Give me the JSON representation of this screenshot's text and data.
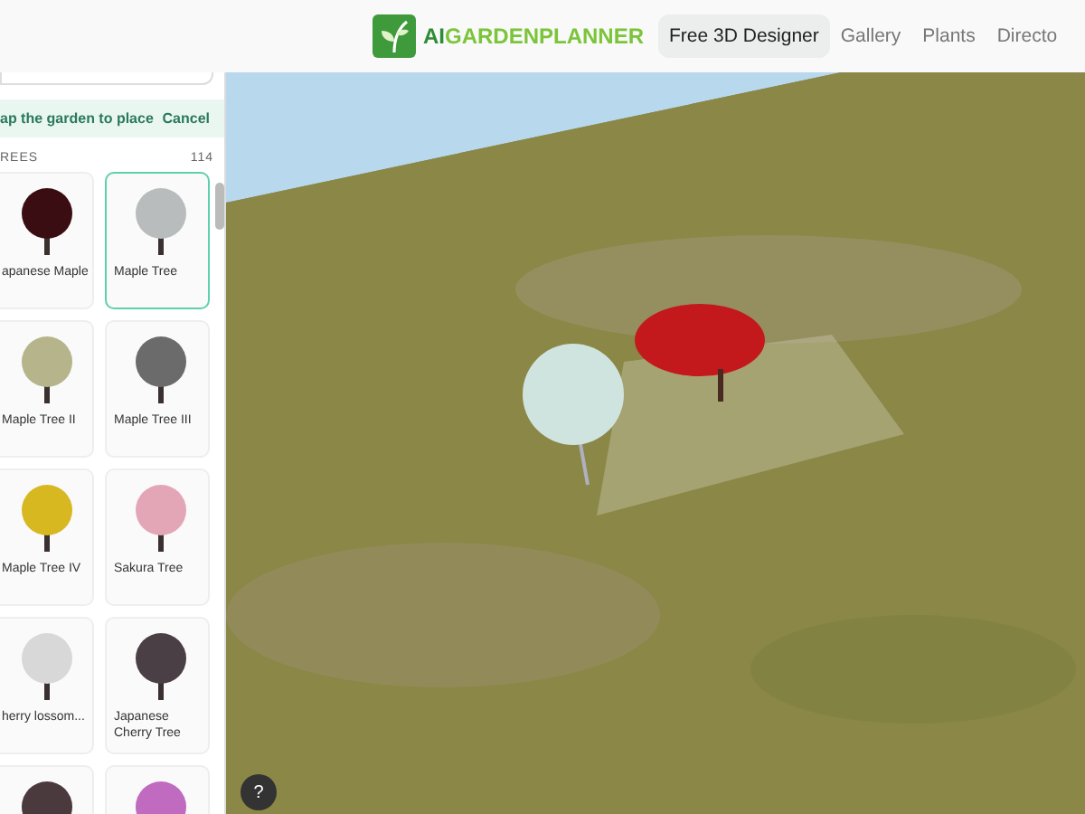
{
  "header": {
    "logo": {
      "prefix": "AI",
      "name": "GARDENPLANNER"
    },
    "nav": [
      {
        "label": "Free 3D Designer",
        "selected": true
      },
      {
        "label": "Gallery",
        "selected": false
      },
      {
        "label": "Plants",
        "selected": false
      },
      {
        "label": "Directo",
        "selected": false
      }
    ]
  },
  "sidebar": {
    "banner": {
      "text": "ap the garden to place",
      "action": "Cancel"
    },
    "section": {
      "title": "REES",
      "count": "114"
    },
    "items": [
      {
        "label": "apanese Maple",
        "color": "#3a0d12",
        "selected": false
      },
      {
        "label": "Maple Tree",
        "color": "#b8bcbc",
        "selected": true
      },
      {
        "label": "Maple Tree II",
        "color": "#b5b48a",
        "selected": false
      },
      {
        "label": "Maple Tree III",
        "color": "#6b6b6b",
        "selected": false
      },
      {
        "label": "Maple Tree IV",
        "color": "#d8b820",
        "selected": false
      },
      {
        "label": "Sakura Tree",
        "color": "#e3a6b6",
        "selected": false
      },
      {
        "label": "herry lossom...",
        "color": "#d8d8d8",
        "selected": false
      },
      {
        "label": "Japanese Cherry Tree",
        "color": "#4a3f44",
        "selected": false
      },
      {
        "color": "#4a3a3e",
        "selected": false
      },
      {
        "color": "#c06ac0",
        "selected": false
      }
    ]
  },
  "help": "?"
}
